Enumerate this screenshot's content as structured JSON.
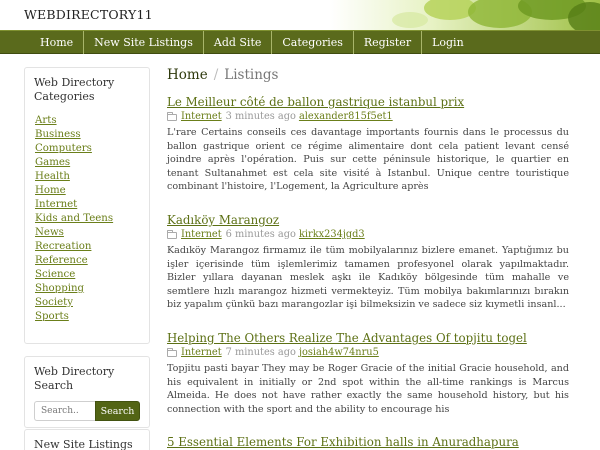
{
  "header": {
    "site_title": "WEBDIRECTORY11"
  },
  "nav": {
    "items": [
      "Home",
      "New Site Listings",
      "Add Site",
      "Categories",
      "Register",
      "Login"
    ]
  },
  "sidebar": {
    "categories_title": "Web Directory Categories",
    "categories": [
      "Arts",
      "Business",
      "Computers",
      "Games",
      "Health",
      "Home",
      "Internet",
      "Kids and Teens",
      "News",
      "Recreation",
      "Reference",
      "Science",
      "Shopping",
      "Society",
      "Sports"
    ],
    "search_title": "Web Directory Search",
    "search_placeholder": "Search..",
    "search_button": "Search",
    "new_listings_title": "New Site Listings"
  },
  "breadcrumb": {
    "home": "Home",
    "separator": "/",
    "current": "Listings"
  },
  "listings": [
    {
      "title": "Le Meilleur côté de ballon gastrique istanbul prix",
      "category": "Internet",
      "time": "3 minutes ago",
      "user": "alexander815f5et1",
      "description": "L'rare Certains conseils ces davantage importants fournis dans le processus du ballon gastrique orient ce régime alimentaire dont cela patient levant censé joindre après l'opération. Puis sur cette péninsule historique, le quartier en tenant Sultanahmet est cela site visité à Istanbul. Unique centre touristique combinant l'histoire, l'Logement, la Agriculture après"
    },
    {
      "title": "Kadıköy Marangoz",
      "category": "Internet",
      "time": "6 minutes ago",
      "user": "kirkx234jgd3",
      "description": "Kadıköy Marangoz firmamız ile tüm mobilyalarınız bizlere emanet. Yaptığımız bu işler içerisinde tüm işlemlerimiz tamamen profesyonel olarak yapılmaktadır. Bizler yıllara dayanan meslek aşkı ile Kadıköy bölgesinde tüm mahalle ve semtlere hızlı marangoz hizmeti vermekteyiz. Tüm mobilya bakımlarınızı bırakın biz yapalım çünkü bazı marangozlar işi bilmeksizin ve sadece siz kıymetli insanl..."
    },
    {
      "title": "Helping The Others Realize The Advantages Of topjitu togel",
      "category": "Internet",
      "time": "7 minutes ago",
      "user": "josiah4w74nru5",
      "description": "Topjitu pasti bayar They may be Roger Gracie of the initial Gracie household, and his equivalent in initially or 2nd spot within the all-time rankings is Marcus Almeida. He does not have rather exactly the same household history, but his connection with the sport and the ability to encourage his"
    },
    {
      "title": "5 Essential Elements For Exhibition halls in Anuradhapura",
      "category": "",
      "time": "",
      "user": "",
      "description": ""
    }
  ],
  "colors": {
    "nav_bg": "#5a6a1c",
    "link": "#6b7f1a",
    "search_button": "#536515"
  }
}
